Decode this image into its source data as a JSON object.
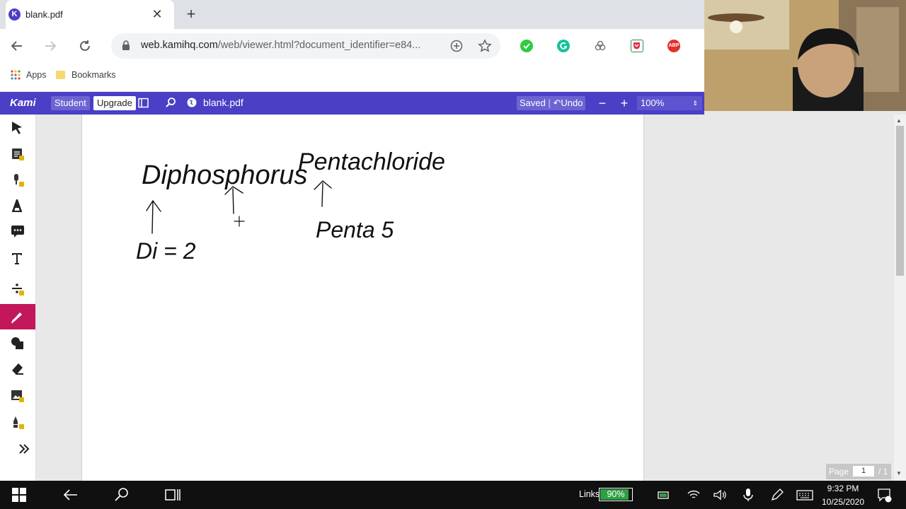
{
  "browser": {
    "tab": {
      "favicon_letter": "K",
      "title": "blank.pdf"
    },
    "url_host": "web.kamihq.com",
    "url_path": "/web/viewer.html?document_identifier=e84...",
    "bookmarks": [
      {
        "label": "Apps"
      },
      {
        "label": "Bookmarks"
      }
    ],
    "extensions": [
      "check-icon",
      "grammarly-icon",
      "link-icon",
      "pocket-icon",
      "adblock-icon"
    ],
    "extension_abp_label": "ABP"
  },
  "kami": {
    "logo": "Kami",
    "student_label": "Student",
    "upgrade_label": "Upgrade",
    "doc_title": "blank.pdf",
    "saved_label": "Saved",
    "undo_label": "Undo",
    "zoom": "100%",
    "accent": "#4a3fc5",
    "active_tool_color": "#c2185b"
  },
  "tools": [
    {
      "name": "select-tool",
      "active": false
    },
    {
      "name": "markup-tool",
      "active": false
    },
    {
      "name": "audio-note-tool",
      "active": false
    },
    {
      "name": "text-highlight-tool",
      "active": false
    },
    {
      "name": "comment-tool",
      "active": false
    },
    {
      "name": "text-box-tool",
      "active": false
    },
    {
      "name": "equation-tool",
      "active": false
    },
    {
      "name": "drawing-tool",
      "active": true
    },
    {
      "name": "shapes-tool",
      "active": false
    },
    {
      "name": "eraser-tool",
      "active": false
    },
    {
      "name": "image-tool",
      "active": false
    },
    {
      "name": "signature-tool",
      "active": false
    },
    {
      "name": "expand-tool",
      "active": false
    }
  ],
  "handwriting": {
    "word1": "Diphosphorus",
    "word2": "Pentachloride",
    "note1": "Di = 2",
    "note2": "Penta 5"
  },
  "page_indicator": {
    "label": "Page",
    "current": "1",
    "total": "/ 1"
  },
  "taskbar": {
    "links_label": "Links",
    "battery_label": "90%",
    "battery_level": 0.9,
    "time": "9:32 PM",
    "date": "10/25/2020"
  }
}
